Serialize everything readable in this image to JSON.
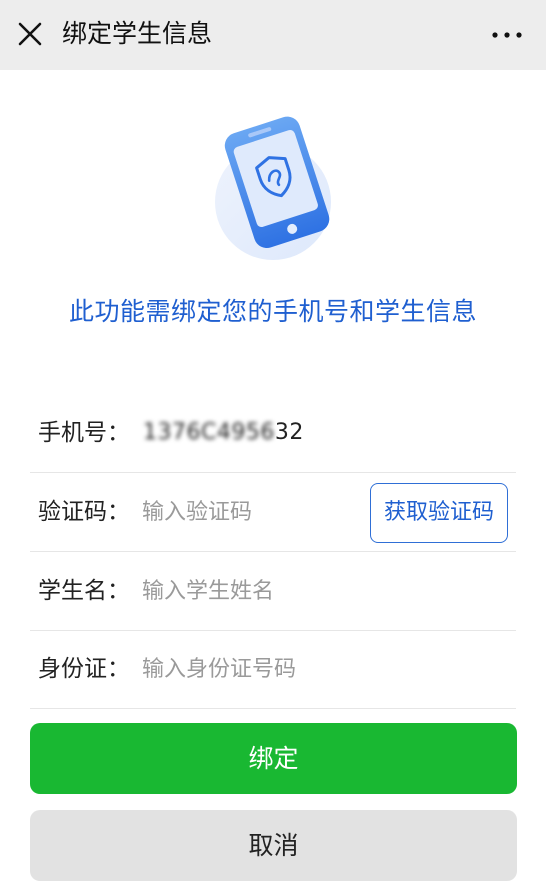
{
  "header": {
    "title": "绑定学生信息",
    "close_icon": "close-icon",
    "more_icon": "more-icon"
  },
  "prompt": {
    "icon": "shield-phone-icon",
    "text": "此功能需绑定您的手机号和学生信息"
  },
  "form": {
    "phone": {
      "label": "手机号：",
      "value_masked": "1376C4956",
      "value_tail": "32"
    },
    "code": {
      "label": "验证码：",
      "placeholder": "输入验证码",
      "button": "获取验证码"
    },
    "student": {
      "label": "学生名：",
      "placeholder": "输入学生姓名"
    },
    "id_card": {
      "label": "身份证：",
      "placeholder": "输入身份证号码"
    }
  },
  "actions": {
    "bind": "绑定",
    "cancel": "取消"
  },
  "colors": {
    "accent": "#1f5fd0",
    "primary_button": "#19b832",
    "secondary_button": "#e2e2e2",
    "topbar": "#ededed"
  }
}
